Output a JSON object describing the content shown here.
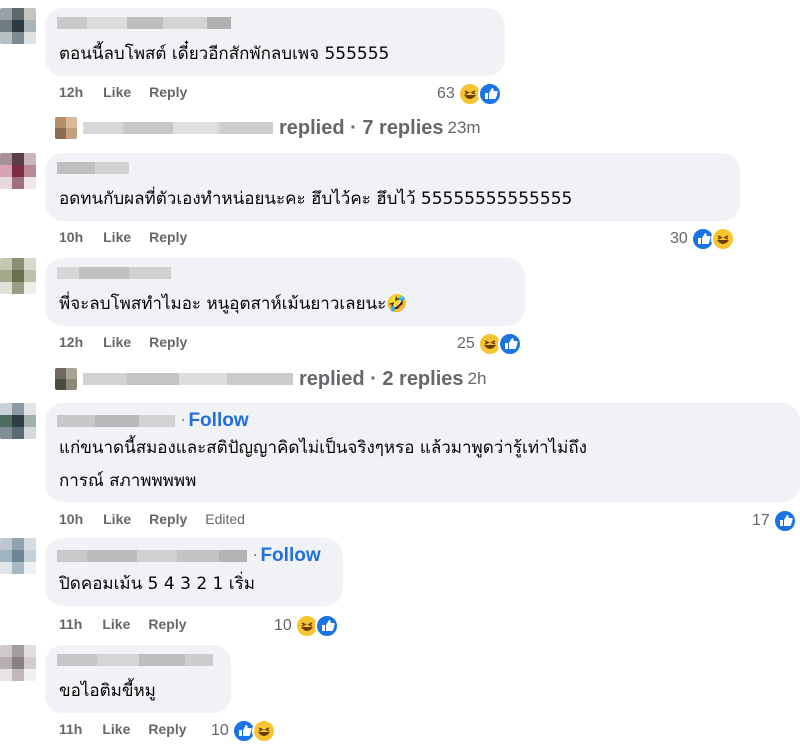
{
  "comments": [
    {
      "text": "ตอนนี้ลบโพสต์ เดี๋ยวอีกสักพักลบเพจ 555555",
      "time": "12h",
      "like": "Like",
      "reply": "Reply",
      "reaction_count": "63",
      "reactions": [
        "haha-icon",
        "like-icon"
      ]
    },
    {
      "text": "อดทนกับผลที่ตัวเองทำหน่อยนะคะ ฮึบไว้คะ ฮึบไว้ 55555555555555",
      "time": "10h",
      "like": "Like",
      "reply": "Reply",
      "reaction_count": "30",
      "reactions": [
        "like-icon",
        "haha-icon"
      ]
    },
    {
      "text": "พี่จะลบโพสทำไมอะ หนูอุตสาห์เม้นยาวเลยนะ🤣",
      "time": "12h",
      "like": "Like",
      "reply": "Reply",
      "reaction_count": "25",
      "reactions": [
        "haha-icon",
        "like-icon"
      ]
    },
    {
      "text_line1": "แก่ขนาดนี้สมองและสติปัญญาคิดไม่เป็นจริงๆหรอ แล้วมาพูดว่ารู้เท่าไม่ถึง",
      "text_line2": "การณ์ สภาพพพพพ",
      "follow": "Follow",
      "time": "10h",
      "like": "Like",
      "reply": "Reply",
      "edited": "Edited",
      "reaction_count": "17",
      "reactions": [
        "like-icon"
      ]
    },
    {
      "text": "ปิดคอมเม้น 5 4 3 2 1 เริ่ม",
      "follow": "Follow",
      "time": "11h",
      "like": "Like",
      "reply": "Reply",
      "reaction_count": "10",
      "reactions": [
        "haha-icon",
        "like-icon"
      ]
    },
    {
      "text": "ขอไอติมขี้หมู",
      "time": "11h",
      "like": "Like",
      "reply": "Reply",
      "reaction_count": "10",
      "reactions": [
        "like-icon",
        "haha-icon"
      ]
    }
  ],
  "reply_threads": [
    {
      "label": "replied · 7 replies",
      "time": "23m"
    },
    {
      "label": "replied · 2 replies",
      "time": "2h"
    }
  ],
  "colors": {
    "bubble": "#f0f2f5",
    "meta": "#65676b",
    "follow": "#216fdb",
    "like_blue": "#1b74e4",
    "haha_yellow": "#f7c531"
  }
}
